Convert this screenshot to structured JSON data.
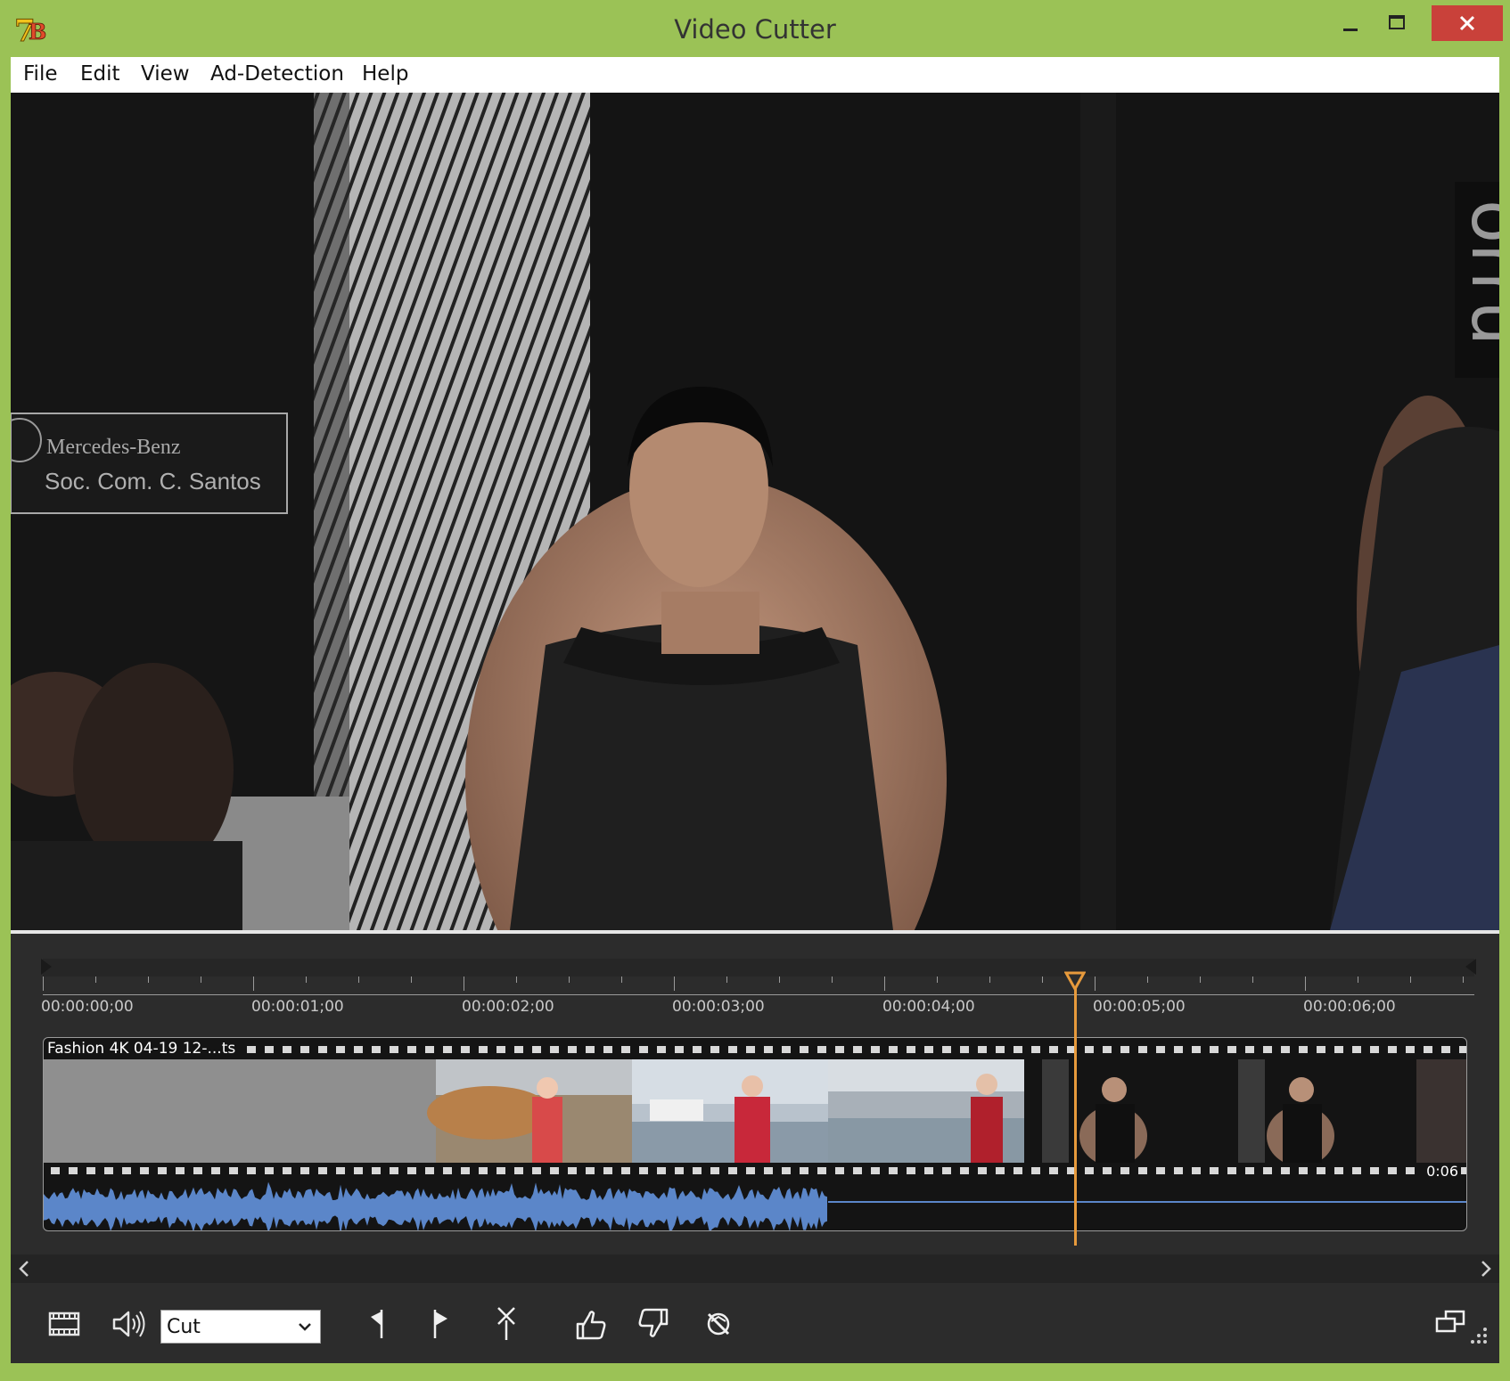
{
  "window": {
    "title": "Video Cutter"
  },
  "menu": {
    "items": [
      "File",
      "Edit",
      "View",
      "Ad-Detection",
      "Help"
    ]
  },
  "video": {
    "sign_line1": "Mercedes-Benz",
    "sign_line2": "Soc. Com. C. Santos"
  },
  "timeline": {
    "ticks": [
      "00:00:00;00",
      "00:00:01;00",
      "00:00:02;00",
      "00:00:03;00",
      "00:00:04;00",
      "00:00:05;00",
      "00:00:06;00"
    ],
    "clip_name": "Fashion 4K 04-19 12-...ts",
    "clip_duration": "0:06",
    "playhead_time_fraction": 0.722
  },
  "toolbar": {
    "mode_value": "Cut",
    "icons": [
      "filmstrip-icon",
      "speaker-icon",
      "mark-in-icon",
      "mark-out-icon",
      "split-icon",
      "thumbs-up-icon",
      "thumbs-down-icon",
      "disable-icon",
      "window-mode-icon"
    ]
  },
  "colors": {
    "accent": "#9bc256",
    "playhead": "#e79a3c",
    "waveform": "#5b86c9",
    "close": "#c9413a"
  }
}
